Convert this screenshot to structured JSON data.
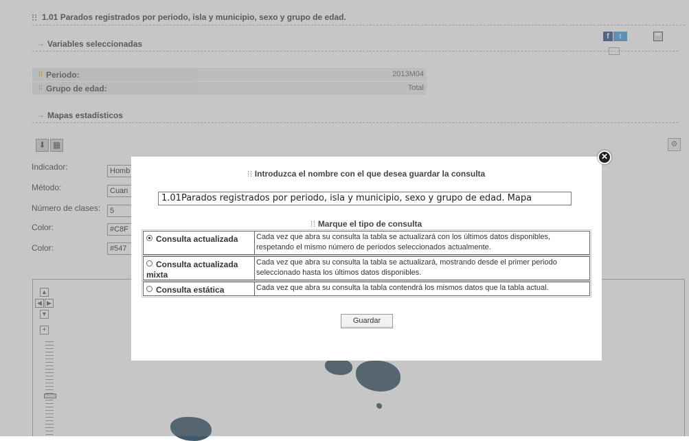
{
  "page": {
    "title": "1.01 Parados registrados por periodo, isla y municipio, sexo y grupo de edad."
  },
  "sections": {
    "variables": "Variables seleccionadas",
    "mapas": "Mapas estadísticos"
  },
  "variables": [
    {
      "label": "Periodo:",
      "value": "2013M04"
    },
    {
      "label": "Grupo de edad:",
      "value": "Total"
    }
  ],
  "form": [
    {
      "label": "Indicador:",
      "value": "Homb"
    },
    {
      "label": "Método:",
      "value": "Cuan"
    },
    {
      "label": "Número de clases:",
      "value": "5"
    },
    {
      "label": "Color:",
      "value": "#C8F"
    },
    {
      "label": "Color:",
      "value": "#547"
    }
  ],
  "dialog": {
    "heading": "Introduzca el nombre con el que desea guardar la consulta",
    "name_value": "1.01Parados registrados por periodo, isla y municipio, sexo y grupo de edad. Mapa",
    "type_heading": "Marque el tipo de consulta",
    "options": [
      {
        "label": "Consulta actualizada",
        "selected": true,
        "description": "Cada vez que abra su consulta la tabla se actualizará con los últimos datos disponibles, respetando el mismo número de periodos seleccionados actualmente."
      },
      {
        "label": "Consulta actualizada mixta",
        "selected": false,
        "description": "Cada vez que abra su consulta la tabla se actualizará, mostrando desde el primer periodo seleccionado hasta los últimos datos disponibles."
      },
      {
        "label": "Consulta estática",
        "selected": false,
        "description": "Cada vez que abra su consulta la tabla contendrá los mismos datos que la tabla actual."
      }
    ],
    "save_label": "Guardar"
  },
  "icons": {
    "close": "close-icon",
    "download": "download-icon",
    "grid": "grid-icon",
    "facebook": "facebook-icon",
    "twitter": "twitter-icon",
    "mail": "mail-icon",
    "save": "save-icon",
    "settings": "settings-icon"
  },
  "colors": {
    "accent": "#e07a22",
    "overlay": "#787878",
    "map_land": "#3f5a6b"
  }
}
